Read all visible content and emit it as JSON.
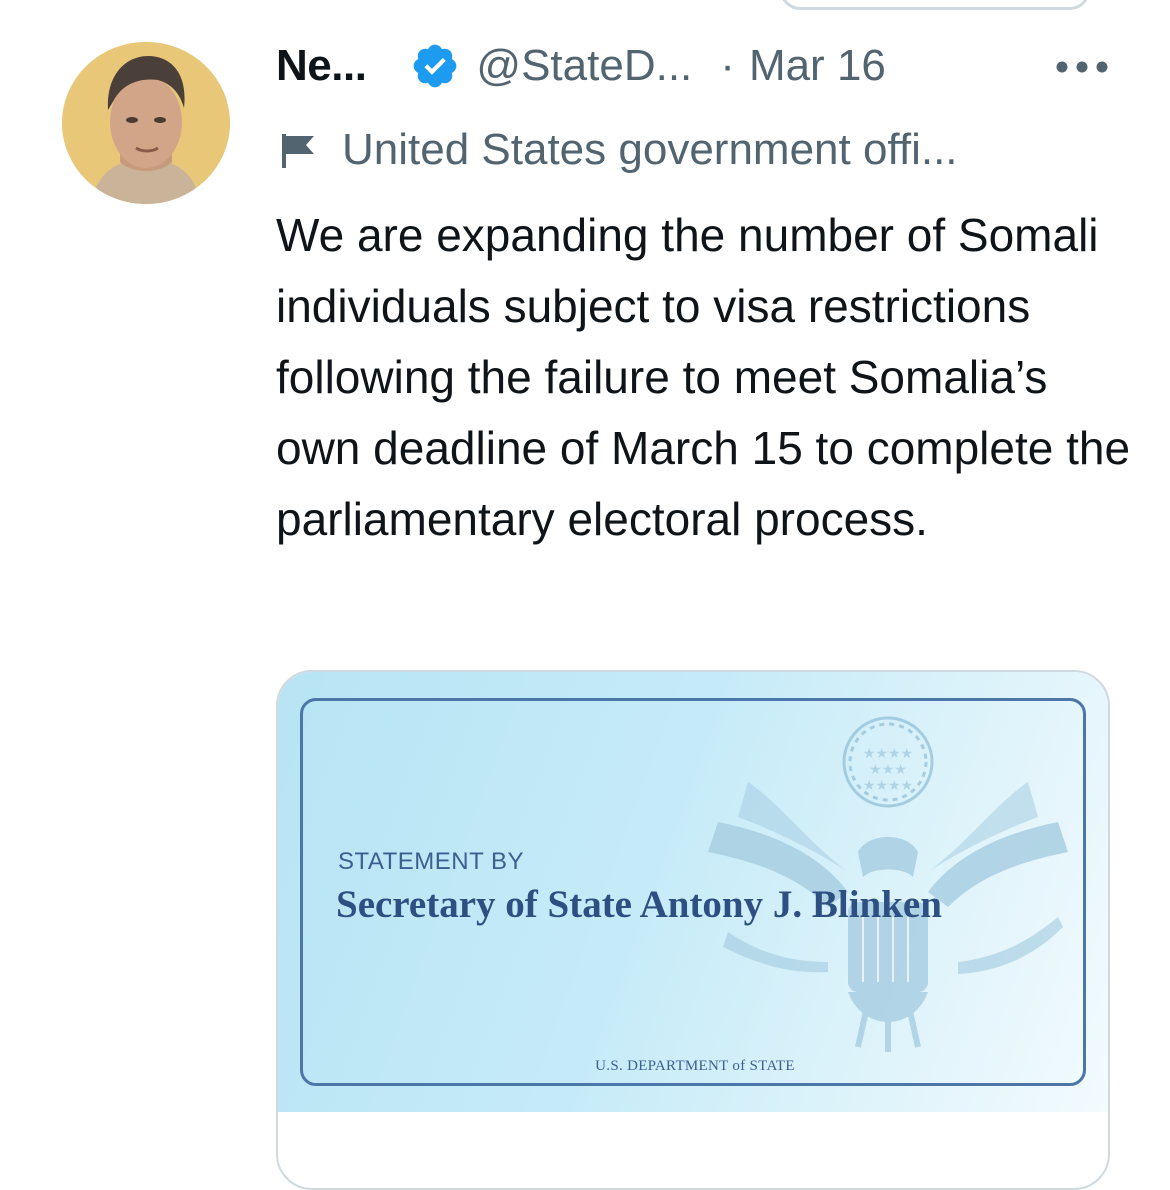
{
  "tweet": {
    "display_name": "Ne...",
    "handle": "@StateD...",
    "separator": "·",
    "date": "Mar 16",
    "account_label": "United States government offi...",
    "text": "We are expanding the number of Somali individuals subject to visa restrictions following the failure to meet Somalia’s own deadline of March 15 to complete the parliamentary electoral process."
  },
  "card": {
    "statement_by": "STATEMENT BY",
    "statement_name": "Secretary of State Antony J. Blinken",
    "department": "U.S. DEPARTMENT of STATE"
  },
  "icons": {
    "verified": "verified-badge-icon",
    "more": "more-dots-icon",
    "label": "flag-icon",
    "seal": "state-department-seal-icon"
  },
  "colors": {
    "verified_blue": "#1d9bf0",
    "secondary_text": "#536471",
    "card_border": "#cfd9de",
    "card_blue": "#b7e4f4",
    "seal_text_blue": "#2d4f82"
  }
}
